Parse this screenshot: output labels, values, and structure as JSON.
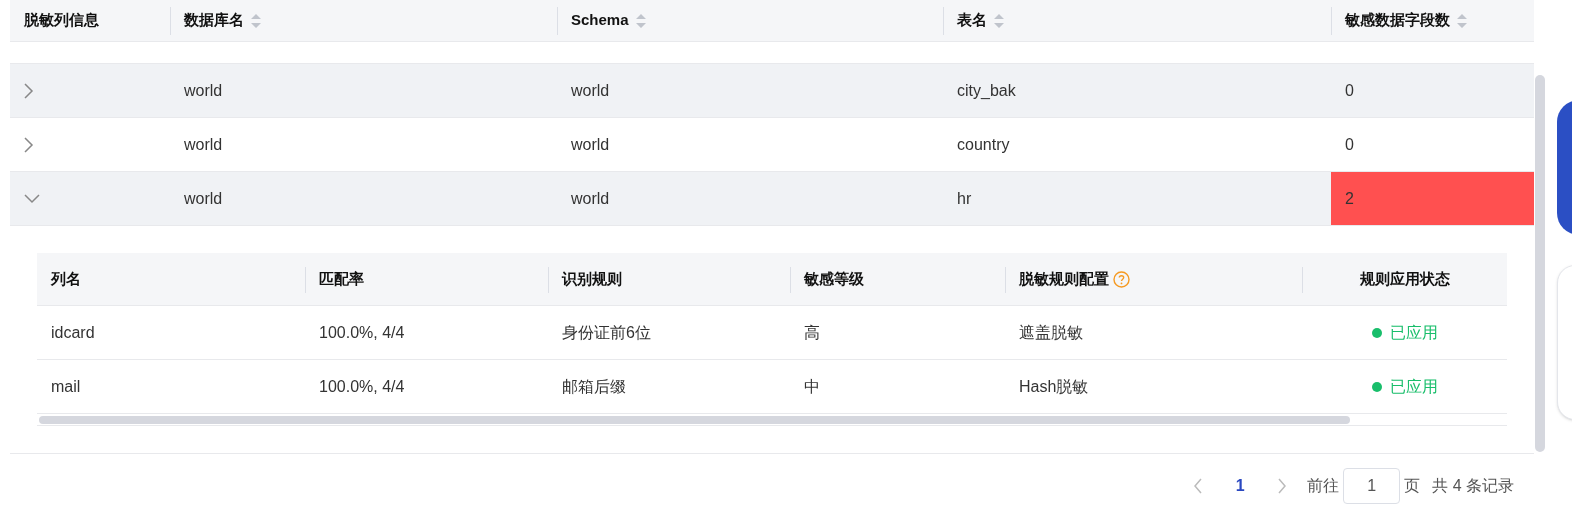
{
  "table": {
    "columns": [
      {
        "label": "脱敏列信息",
        "sortable": false
      },
      {
        "label": "数据库名",
        "sortable": true
      },
      {
        "label": "Schema",
        "sortable": true
      },
      {
        "label": "表名",
        "sortable": true
      },
      {
        "label": "敏感数据字段数",
        "sortable": true
      }
    ],
    "rows": [
      {
        "expanded": false,
        "shaded": true,
        "flagged": false,
        "cells": [
          "",
          "world",
          "world",
          "city_bak",
          "0"
        ]
      },
      {
        "expanded": false,
        "shaded": false,
        "flagged": false,
        "cells": [
          "",
          "world",
          "world",
          "country",
          "0"
        ]
      },
      {
        "expanded": true,
        "shaded": true,
        "flagged": true,
        "cells": [
          "",
          "world",
          "world",
          "hr",
          "2"
        ],
        "detail": {
          "columns": [
            {
              "label": "列名",
              "help": false
            },
            {
              "label": "匹配率",
              "help": false
            },
            {
              "label": "识别规则",
              "help": false
            },
            {
              "label": "敏感等级",
              "help": false
            },
            {
              "label": "脱敏规则配置",
              "help": true
            },
            {
              "label": "规则应用状态",
              "help": false
            }
          ],
          "rows": [
            {
              "cells": [
                "idcard",
                "100.0%, 4/4",
                "身份证前6位",
                "高",
                "遮盖脱敏"
              ],
              "status": {
                "label": "已应用",
                "color": "#19be6b"
              }
            },
            {
              "cells": [
                "mail",
                "100.0%, 4/4",
                "邮箱后缀",
                "中",
                "Hash脱敏"
              ],
              "status": {
                "label": "已应用",
                "color": "#19be6b"
              }
            }
          ]
        }
      }
    ]
  },
  "pagination": {
    "pages": [
      {
        "label": "1",
        "selected": true
      }
    ],
    "goto_label": "前往",
    "goto_value": "1",
    "page_unit": "页",
    "total": "共 4 条记录"
  }
}
